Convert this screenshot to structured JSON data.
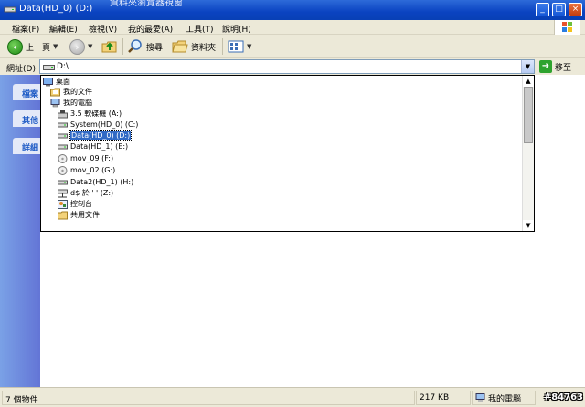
{
  "window": {
    "title": "Data(HD_0) (D:)",
    "clipped_title": "資料夾瀏覽器視窗"
  },
  "menu": {
    "items": [
      "檔案(F)",
      "編輯(E)",
      "檢視(V)",
      "我的最愛(A)",
      "工具(T)",
      "說明(H)"
    ]
  },
  "toolbar": {
    "back_label": "上一頁",
    "search_label": "搜尋",
    "folders_label": "資料夾"
  },
  "address": {
    "label": "網址(D)",
    "value": "D:\\",
    "go_label": "移至"
  },
  "left_pane": {
    "tasks": [
      "檔案",
      "其他",
      "詳細"
    ]
  },
  "dropdown": {
    "items": [
      {
        "icon": "desktop-icon",
        "label": "桌面"
      },
      {
        "icon": "folder-docs-icon",
        "label": "我的文件"
      },
      {
        "icon": "computer-icon",
        "label": "我的電腦"
      },
      {
        "icon": "floppy-drive-icon",
        "label": "3.5 軟碟機 (A:)"
      },
      {
        "icon": "hard-drive-icon",
        "label": "System(HD_0) (C:)"
      },
      {
        "icon": "hard-drive-icon",
        "label": "Data(HD_0) (D:)",
        "selected": true
      },
      {
        "icon": "hard-drive-icon",
        "label": "Data(HD_1) (E:)"
      },
      {
        "icon": "cd-drive-icon",
        "label": "mov_09 (F:)"
      },
      {
        "icon": "cd-drive-icon",
        "label": "mov_02 (G:)"
      },
      {
        "icon": "hard-drive-icon",
        "label": "Data2(HD_1) (H:)"
      },
      {
        "icon": "network-drive-icon",
        "label": "d$ 於 '        ' (Z:)"
      },
      {
        "icon": "control-panel-icon",
        "label": "控制台"
      },
      {
        "icon": "folder-icon",
        "label": "共用文件"
      }
    ]
  },
  "status": {
    "objects": "7 個物件",
    "size": "217 KB",
    "location": "我的電腦"
  },
  "watermark": "#84763",
  "colors": {
    "title_bar": "#0a43c1",
    "selection": "#316ac5",
    "chrome": "#ece9d8",
    "left_pane": "#6f8ee0"
  }
}
